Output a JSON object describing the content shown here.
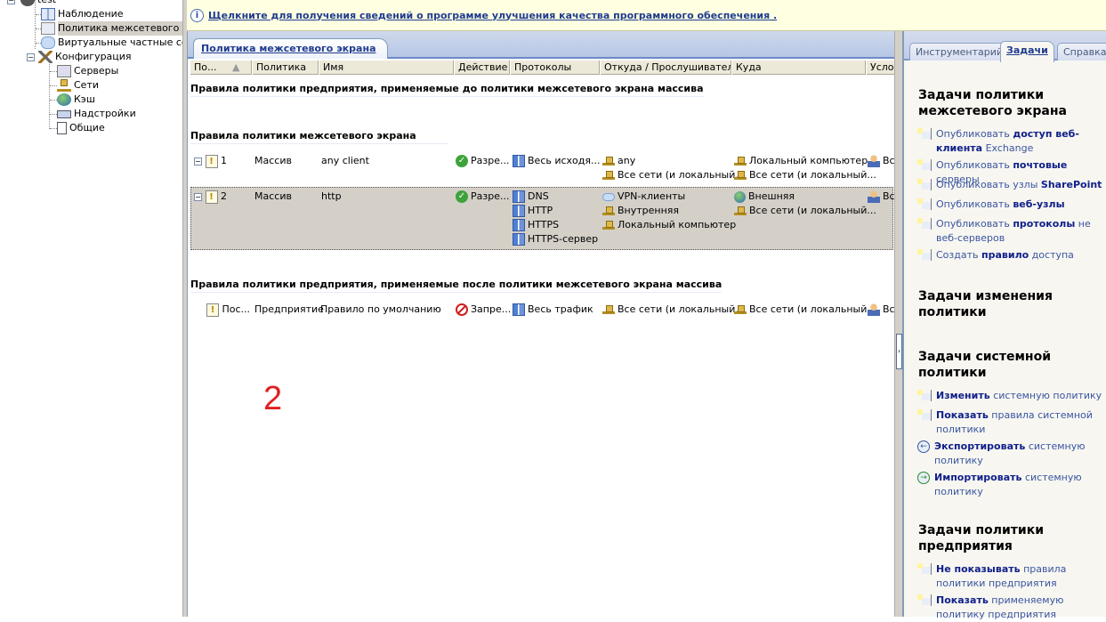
{
  "tree": {
    "root": "test",
    "items": [
      "Наблюдение",
      "Политика межсетевого экр",
      "Виртуальные частные сети",
      "Конфигурация"
    ],
    "config_children": [
      "Серверы",
      "Сети",
      "Кэш",
      "Надстройки",
      "Общие"
    ]
  },
  "info_bar": {
    "text": "Щелкните для получения сведений о программе улучшения качества программного обеспечения ."
  },
  "main": {
    "tab": "Политика межсетевого экрана",
    "columns": [
      "По...",
      "Политика",
      "Имя",
      "Действие",
      "Протоколы",
      "Откуда / Прослушиватель",
      "Куда",
      "Усло"
    ],
    "section_before": "Правила политики предприятия, применяемые до политики межсетевого экрана массива",
    "section_firewall": "Правила политики межсетевого экрана",
    "section_after": "Правила политики предприятия, применяемые после политики межсетевого экрана массива",
    "rules": [
      {
        "order": "1",
        "policy": "Массив",
        "name": "any client",
        "action": "Разре...",
        "protocols": [
          "Весь исходя..."
        ],
        "from": [
          "any",
          "Все сети (и локальный..."
        ],
        "to": [
          "Локальный компьютер",
          "Все сети (и локальный..."
        ],
        "cond": "Вс"
      },
      {
        "order": "2",
        "policy": "Массив",
        "name": "http",
        "action": "Разре...",
        "protocols": [
          "DNS",
          "HTTP",
          "HTTPS",
          "HTTPS-сервер"
        ],
        "from": [
          "VPN-клиенты",
          "Внутренняя",
          "Локальный компьютер"
        ],
        "to": [
          "Внешняя",
          "Все сети (и локальный..."
        ],
        "cond": "Вс"
      }
    ],
    "default_rule": {
      "order": "Пос...",
      "policy": "Предприятие",
      "name": "Правило по умолчанию",
      "action": "Запре...",
      "protocols": [
        "Весь трафик"
      ],
      "from": [
        "Все сети (и локальный..."
      ],
      "to": [
        "Все сети (и локальный..."
      ],
      "cond": "Вс"
    },
    "annotation": "2"
  },
  "right": {
    "tabs": [
      "Инструментарий",
      "Задачи",
      "Справка"
    ],
    "h1": "Задачи политики межсетевого экрана",
    "tasks1": [
      {
        "a": "Опубликовать ",
        "b": "доступ веб-клиента",
        "c": " Exchange"
      },
      {
        "a": "Опубликовать ",
        "b": "почтовые",
        "c": " серверы"
      },
      {
        "a": "Опубликовать узлы ",
        "b": "SharePoint",
        "c": ""
      },
      {
        "a": "Опубликовать ",
        "b": "веб-узлы",
        "c": ""
      },
      {
        "a": "Опубликовать ",
        "b": "протоколы",
        "c": " не веб-серверов"
      },
      {
        "a": "Создать ",
        "b": "правило",
        "c": " доступа"
      }
    ],
    "h2": "Задачи изменения политики",
    "h3": "Задачи системной политики",
    "tasks3": [
      {
        "a": "",
        "b": "Изменить",
        "c": " системную политику"
      },
      {
        "a": "",
        "b": "Показать",
        "c": " правила системной политики"
      },
      {
        "a": "",
        "b": "Экспортировать",
        "c": " системную политику"
      },
      {
        "a": "",
        "b": "Импортировать",
        "c": " системную политику"
      }
    ],
    "h4": "Задачи политики предприятия",
    "tasks4": [
      {
        "a": "",
        "b": "Не показывать",
        "c": " правила политики предприятия"
      },
      {
        "a": "",
        "b": "Показать",
        "c": " применяемую политику предприятия"
      }
    ]
  }
}
